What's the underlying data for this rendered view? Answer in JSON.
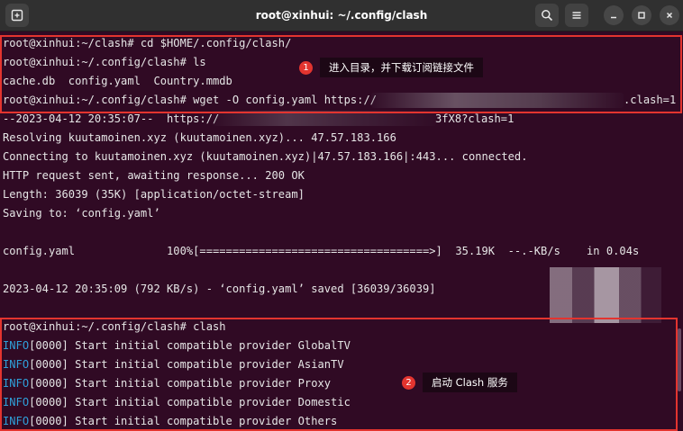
{
  "window": {
    "title": "root@xinhui: ~/.config/clash",
    "icons": {
      "new_tab": "new-tab-icon",
      "search": "search-icon",
      "menu": "menu-icon",
      "minimize": "minimize-icon",
      "maximize": "maximize-icon",
      "close": "close-icon"
    }
  },
  "terminal": {
    "lines": [
      "root@xinhui:~/clash# cd $HOME/.config/clash/",
      "root@xinhui:~/.config/clash# ls",
      "cache.db  config.yaml  Country.mmdb",
      "root@xinhui:~/.config/clash# wget -O config.yaml https://",
      "--2023-04-12 20:35:07--  https://",
      "Resolving kuutamoinen.xyz (kuutamoinen.xyz)... 47.57.183.166",
      "Connecting to kuutamoinen.xyz (kuutamoinen.xyz)|47.57.183.166|:443... connected.",
      "HTTP request sent, awaiting response... 200 OK",
      "Length: 36039 (35K) [application/octet-stream]",
      "Saving to: ‘config.yaml’",
      "",
      "config.yaml              100%[===================================>]  35.19K  --.-KB/s    in 0.04s",
      "",
      "2023-04-12 20:35:09 (792 KB/s) - ‘config.yaml’ saved [36039/36039]",
      "",
      "root@xinhui:~/.config/clash# clash"
    ],
    "wget_url_tail": ".clash=1",
    "wget_url_tail2": "3fX8?clash=1",
    "info_lines": [
      {
        "tag": "INFO",
        "rest": "[0000] Start initial compatible provider GlobalTV"
      },
      {
        "tag": "INFO",
        "rest": "[0000] Start initial compatible provider AsianTV"
      },
      {
        "tag": "INFO",
        "rest": "[0000] Start initial compatible provider Proxy"
      },
      {
        "tag": "INFO",
        "rest": "[0000] Start initial compatible provider Domestic"
      },
      {
        "tag": "INFO",
        "rest": "[0000] Start initial compatible provider Others"
      }
    ]
  },
  "annotations": [
    {
      "number": "1",
      "text": "进入目录，并下载订阅链接文件"
    },
    {
      "number": "2",
      "text": "启动 Clash 服务"
    }
  ],
  "colors": {
    "terminal_bg": "#300a24",
    "titlebar_bg": "#303030",
    "highlight_border": "#e3342f",
    "info_tag": "#2f9fd8"
  }
}
